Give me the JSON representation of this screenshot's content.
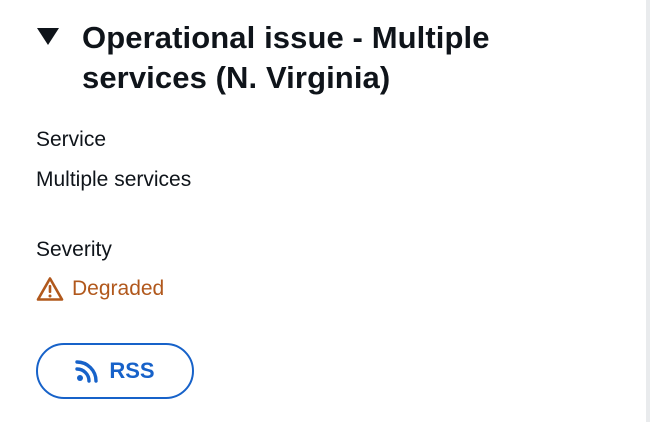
{
  "event": {
    "title": "Operational issue - Multiple services (N. Virginia)",
    "expanded": true
  },
  "details": {
    "service_label": "Service",
    "service_value": "Multiple services",
    "severity_label": "Severity",
    "severity_value": "Degraded",
    "severity_icon": "warning-triangle-icon",
    "severity_color": "#b1581c"
  },
  "actions": {
    "rss_label": "RSS",
    "rss_icon": "rss-feed-icon",
    "accent_color": "#1762c9"
  }
}
